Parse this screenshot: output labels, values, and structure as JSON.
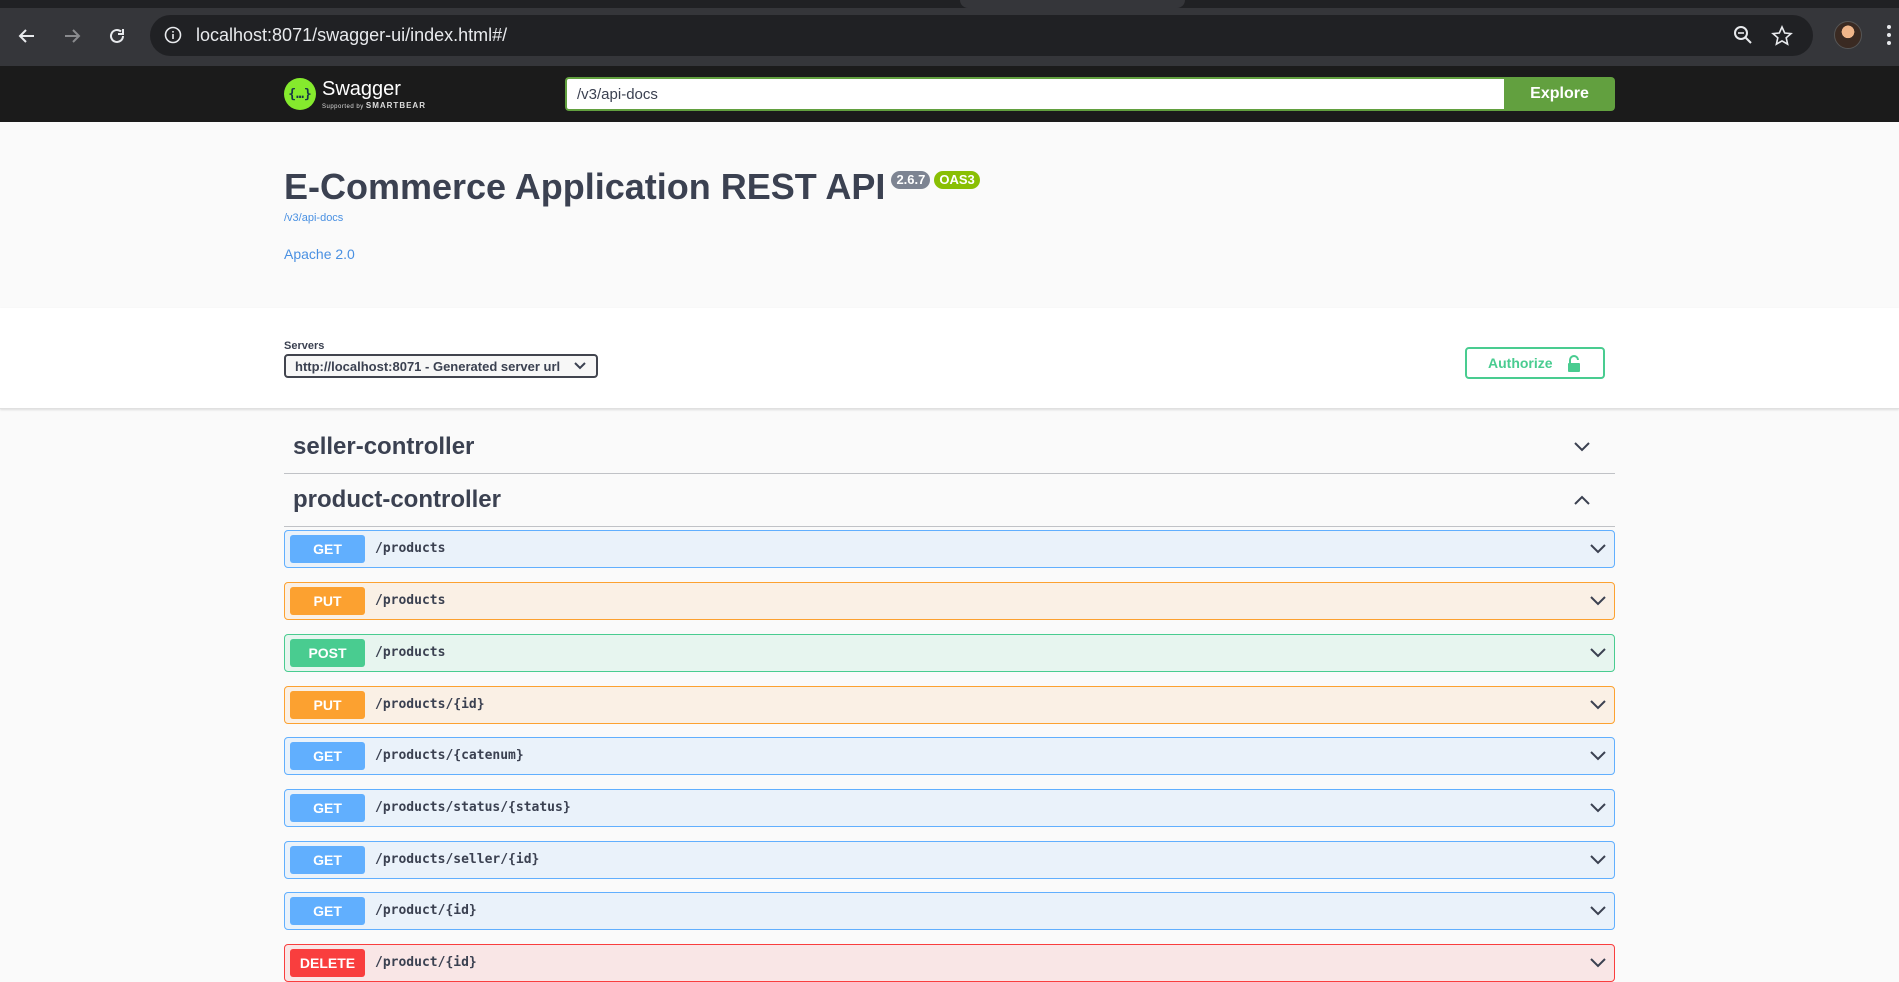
{
  "browser": {
    "url": "localhost:8071/swagger-ui/index.html#/"
  },
  "topbar": {
    "logo_title": "Swagger",
    "logo_supported_by": "Supported by",
    "logo_brand": "SMARTBEAR",
    "explore_value": "/v3/api-docs",
    "explore_label": "Explore"
  },
  "info": {
    "title": "E-Commerce Application REST API",
    "version": "2.6.7",
    "oas": "OAS3",
    "spec_url": "/v3/api-docs",
    "license": "Apache 2.0"
  },
  "servers": {
    "label": "Servers",
    "selected": "http://localhost:8071 - Generated server url"
  },
  "authorize": {
    "label": "Authorize"
  },
  "tags": [
    {
      "name": "seller-controller",
      "expanded": false
    },
    {
      "name": "product-controller",
      "expanded": true
    }
  ],
  "operations": [
    {
      "method": "GET",
      "path": "/products"
    },
    {
      "method": "PUT",
      "path": "/products"
    },
    {
      "method": "POST",
      "path": "/products"
    },
    {
      "method": "PUT",
      "path": "/products/{id}"
    },
    {
      "method": "GET",
      "path": "/products/{catenum}"
    },
    {
      "method": "GET",
      "path": "/products/status/{status}"
    },
    {
      "method": "GET",
      "path": "/products/seller/{id}"
    },
    {
      "method": "GET",
      "path": "/product/{id}"
    },
    {
      "method": "DELETE",
      "path": "/product/{id}"
    }
  ],
  "colors": {
    "get": "#61affe",
    "put": "#fca130",
    "post": "#49cc90",
    "delete": "#f93e3e",
    "swagger_green": "#62a03f"
  }
}
